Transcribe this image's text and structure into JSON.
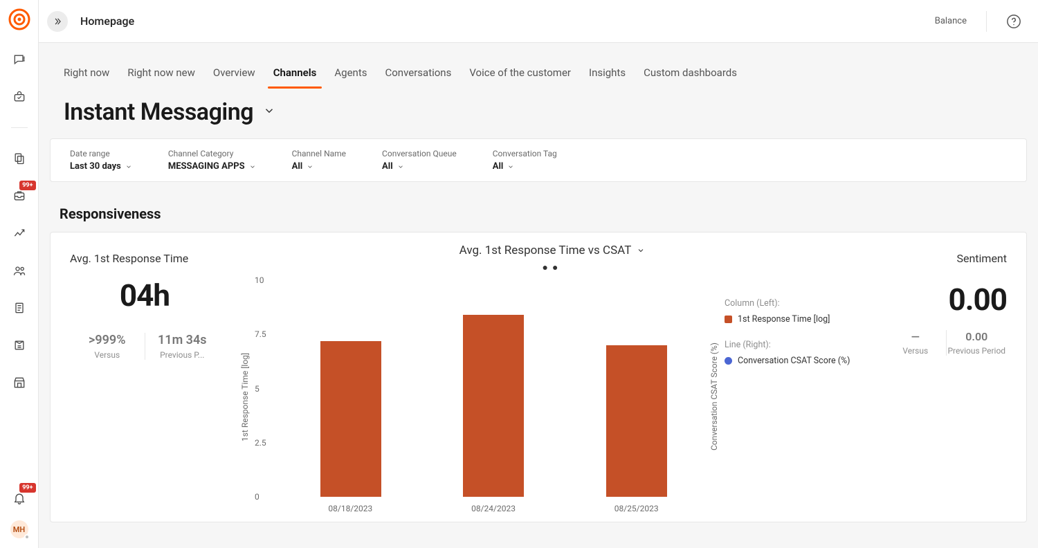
{
  "header": {
    "breadcrumb": "Homepage",
    "balance_label": "Balance"
  },
  "rail": {
    "badge_inbox": "99+",
    "badge_bell": "99+",
    "avatar_initials": "MH"
  },
  "tabs": [
    {
      "id": "right-now",
      "label": "Right now",
      "active": false
    },
    {
      "id": "right-now-new",
      "label": "Right now new",
      "active": false
    },
    {
      "id": "overview",
      "label": "Overview",
      "active": false
    },
    {
      "id": "channels",
      "label": "Channels",
      "active": true
    },
    {
      "id": "agents",
      "label": "Agents",
      "active": false
    },
    {
      "id": "conversations",
      "label": "Conversations",
      "active": false
    },
    {
      "id": "voc",
      "label": "Voice of the customer",
      "active": false
    },
    {
      "id": "insights",
      "label": "Insights",
      "active": false
    },
    {
      "id": "custom",
      "label": "Custom dashboards",
      "active": false
    }
  ],
  "page_title": "Instant Messaging",
  "filters": {
    "date_range": {
      "label": "Date range",
      "value": "Last 30 days"
    },
    "category": {
      "label": "Channel Category",
      "value": "MESSAGING APPS"
    },
    "channel_name": {
      "label": "Channel Name",
      "value": "All"
    },
    "queue": {
      "label": "Conversation Queue",
      "value": "All"
    },
    "tag": {
      "label": "Conversation Tag",
      "value": "All"
    }
  },
  "section_title": "Responsiveness",
  "kpi": {
    "title": "Avg. 1st Response Time",
    "value": "04h",
    "versus_pct": ">999%",
    "versus_label": "Versus",
    "prev_value": "11m 34s",
    "prev_label": "Previous P..."
  },
  "chart": {
    "title": "Avg. 1st Response Time vs CSAT",
    "y_label_left": "1st Response Time [log]",
    "y_label_right": "Conversation CSAT Score (%)",
    "legend_left_head": "Column (Left):",
    "legend_left_item": "1st Response Time [log]",
    "legend_right_head": "Line (Right):",
    "legend_right_item": "Conversation CSAT Score (%)",
    "colors": {
      "bar": "#c55027",
      "csat": "#4b66d3"
    }
  },
  "sentiment": {
    "title": "Sentiment",
    "value": "0.00",
    "versus_value": "—",
    "versus_label": "Versus",
    "prev_value": "0.00",
    "prev_label": "Previous Period"
  },
  "chart_data": {
    "type": "bar",
    "categories": [
      "08/18/2023",
      "08/24/2023",
      "08/25/2023"
    ],
    "values": [
      7.2,
      8.4,
      7.0
    ],
    "title": "Avg. 1st Response Time vs CSAT",
    "xlabel": "",
    "ylabel": "1st Response Time [log]",
    "y2label": "Conversation CSAT Score (%)",
    "ylim": [
      0,
      10
    ],
    "yticks": [
      0,
      2.5,
      5,
      7.5,
      10
    ],
    "series": [
      {
        "name": "1st Response Time [log]",
        "type": "column",
        "axis": "left",
        "values": [
          7.2,
          8.4,
          7.0
        ]
      },
      {
        "name": "Conversation CSAT Score (%)",
        "type": "line",
        "axis": "right",
        "values": []
      }
    ]
  }
}
